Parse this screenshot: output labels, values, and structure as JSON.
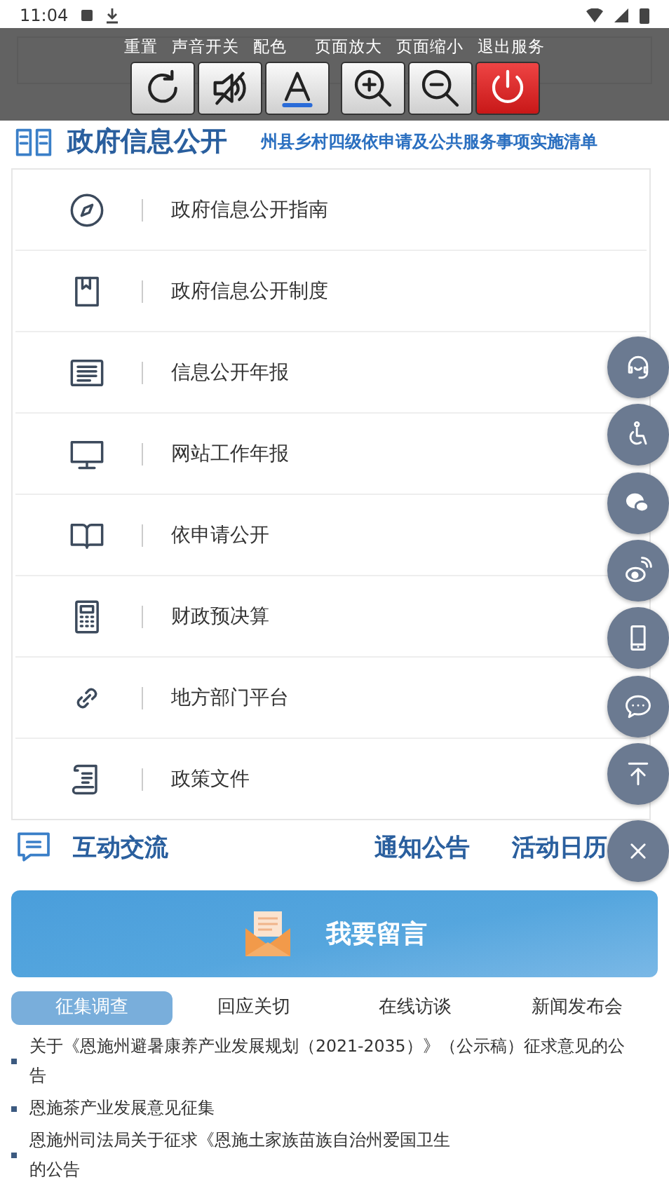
{
  "status_bar": {
    "time": "11:04"
  },
  "accessibility_toolbar": {
    "labels": [
      "重置",
      "声音开关",
      "配色",
      "页面放大",
      "页面缩小",
      "退出服务"
    ],
    "buttons": [
      {
        "kind": "reset"
      },
      {
        "kind": "sound"
      },
      {
        "kind": "color"
      },
      {
        "kind": "zoom_in"
      },
      {
        "kind": "zoom_out"
      },
      {
        "kind": "exit"
      }
    ]
  },
  "info_section": {
    "title": "政府信息公开",
    "link": "州县乡村四级依申请及公共服务事项实施清单",
    "items": [
      {
        "kind": "compass",
        "label": "政府信息公开指南"
      },
      {
        "kind": "book",
        "label": "政府信息公开制度"
      },
      {
        "kind": "list",
        "label": "信息公开年报"
      },
      {
        "kind": "monitor",
        "label": "网站工作年报"
      },
      {
        "kind": "open_book",
        "label": "依申请公开"
      },
      {
        "kind": "calculator",
        "label": "财政预决算"
      },
      {
        "kind": "link",
        "label": "地方部门平台"
      },
      {
        "kind": "scroll",
        "label": "政策文件"
      }
    ]
  },
  "interaction_section": {
    "title": "互动交流",
    "tabs_right": [
      "通知公告",
      "活动日历"
    ],
    "banner": "我要留言",
    "tabs": [
      {
        "label": "征集调查",
        "selected": true
      },
      {
        "label": "回应关切",
        "selected": false
      },
      {
        "label": "在线访谈",
        "selected": false
      },
      {
        "label": "新闻发布会",
        "selected": false
      }
    ],
    "items": [
      {
        "lines": [
          "关于《恩施州避暑康养产业发展规划（2021-2035）》（公示稿）征求意见的公",
          "告"
        ]
      },
      {
        "lines": [
          "恩施茶产业发展意见征集"
        ]
      },
      {
        "lines": [
          "恩施州司法局关于征求《恩施土家族苗族自治州爱国卫生",
          "的公告"
        ]
      }
    ]
  },
  "floating_buttons": [
    {
      "kind": "support"
    },
    {
      "kind": "accessibility"
    },
    {
      "kind": "wechat"
    },
    {
      "kind": "weibo"
    },
    {
      "kind": "mobile"
    },
    {
      "kind": "chat"
    },
    {
      "kind": "top"
    },
    {
      "kind": "close"
    }
  ]
}
